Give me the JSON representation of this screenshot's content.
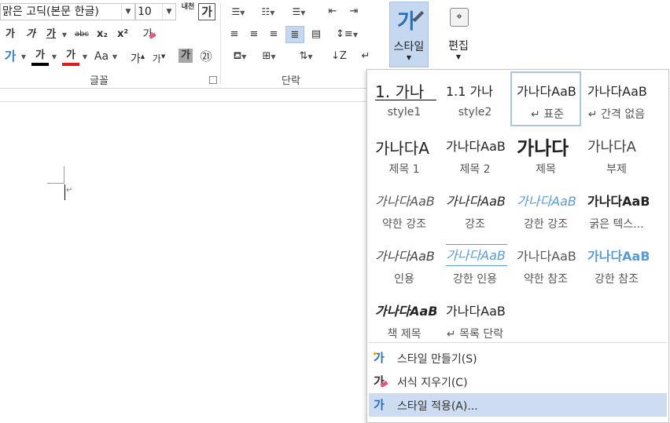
{
  "font": {
    "name": "맑은 고딕(본문 한글)",
    "size": "10",
    "grow_label": "가",
    "shrink_label": "가",
    "case_label": "Aa",
    "phonetic_label": "내천",
    "border_char_label": "가",
    "clear_format_label": "가",
    "char_shading_label": "가",
    "enclose_label": "㉑",
    "bold": "가",
    "italic": "가",
    "underline": "가",
    "strike": "abc",
    "sub": "x₂",
    "sup": "x²",
    "text_effect": "가",
    "highlight": "가",
    "font_color": "가",
    "grow_small1": "가",
    "grow_small2": "가"
  },
  "groups": {
    "font_label": "글꼴",
    "paragraph_label": "단락"
  },
  "styles_button": {
    "icon_char": "가",
    "label": "스타일"
  },
  "edit_button": {
    "label": "편집"
  },
  "gallery": {
    "styles": [
      {
        "preview": "1.  가나",
        "name": "style1"
      },
      {
        "preview": "1.1  가나",
        "name": "style2"
      },
      {
        "preview": "가나다AaB",
        "name": "↵ 표준"
      },
      {
        "preview": "가나다AaB",
        "name": "↵ 간격 없음"
      },
      {
        "preview": "가나다A",
        "name": "제목 1"
      },
      {
        "preview": "가나다AaB",
        "name": "제목 2"
      },
      {
        "preview": "가나다",
        "name": "제목"
      },
      {
        "preview": "가나다A",
        "name": "부제"
      },
      {
        "preview": "가나다AaB",
        "name": "약한 강조"
      },
      {
        "preview": "가나다AaB",
        "name": "강조"
      },
      {
        "preview": "가나다AaB",
        "name": "강한 강조"
      },
      {
        "preview": "가나다AaB",
        "name": "굵은 텍스..."
      },
      {
        "preview": "가나다AaB",
        "name": "인용"
      },
      {
        "preview": "가나다AaB",
        "name": "강한 인용"
      },
      {
        "preview": "가나다AaB",
        "name": "약한 참조"
      },
      {
        "preview": "가나다AaB",
        "name": "강한 참조"
      },
      {
        "preview": "가나다AaB",
        "name": "책 제목"
      },
      {
        "preview": "가나다AaB",
        "name": "↵ 목록 단락"
      }
    ],
    "menu": {
      "create": "스타일 만들기(S)",
      "clear": "서식 지우기(C)",
      "apply": "스타일 적용(A)..."
    }
  },
  "colors": {
    "accent": "#2d6fb7",
    "highlight_bar": "#000000",
    "font_color_bar": "#e01b1b",
    "selected_bg": "#c5d8ef"
  }
}
